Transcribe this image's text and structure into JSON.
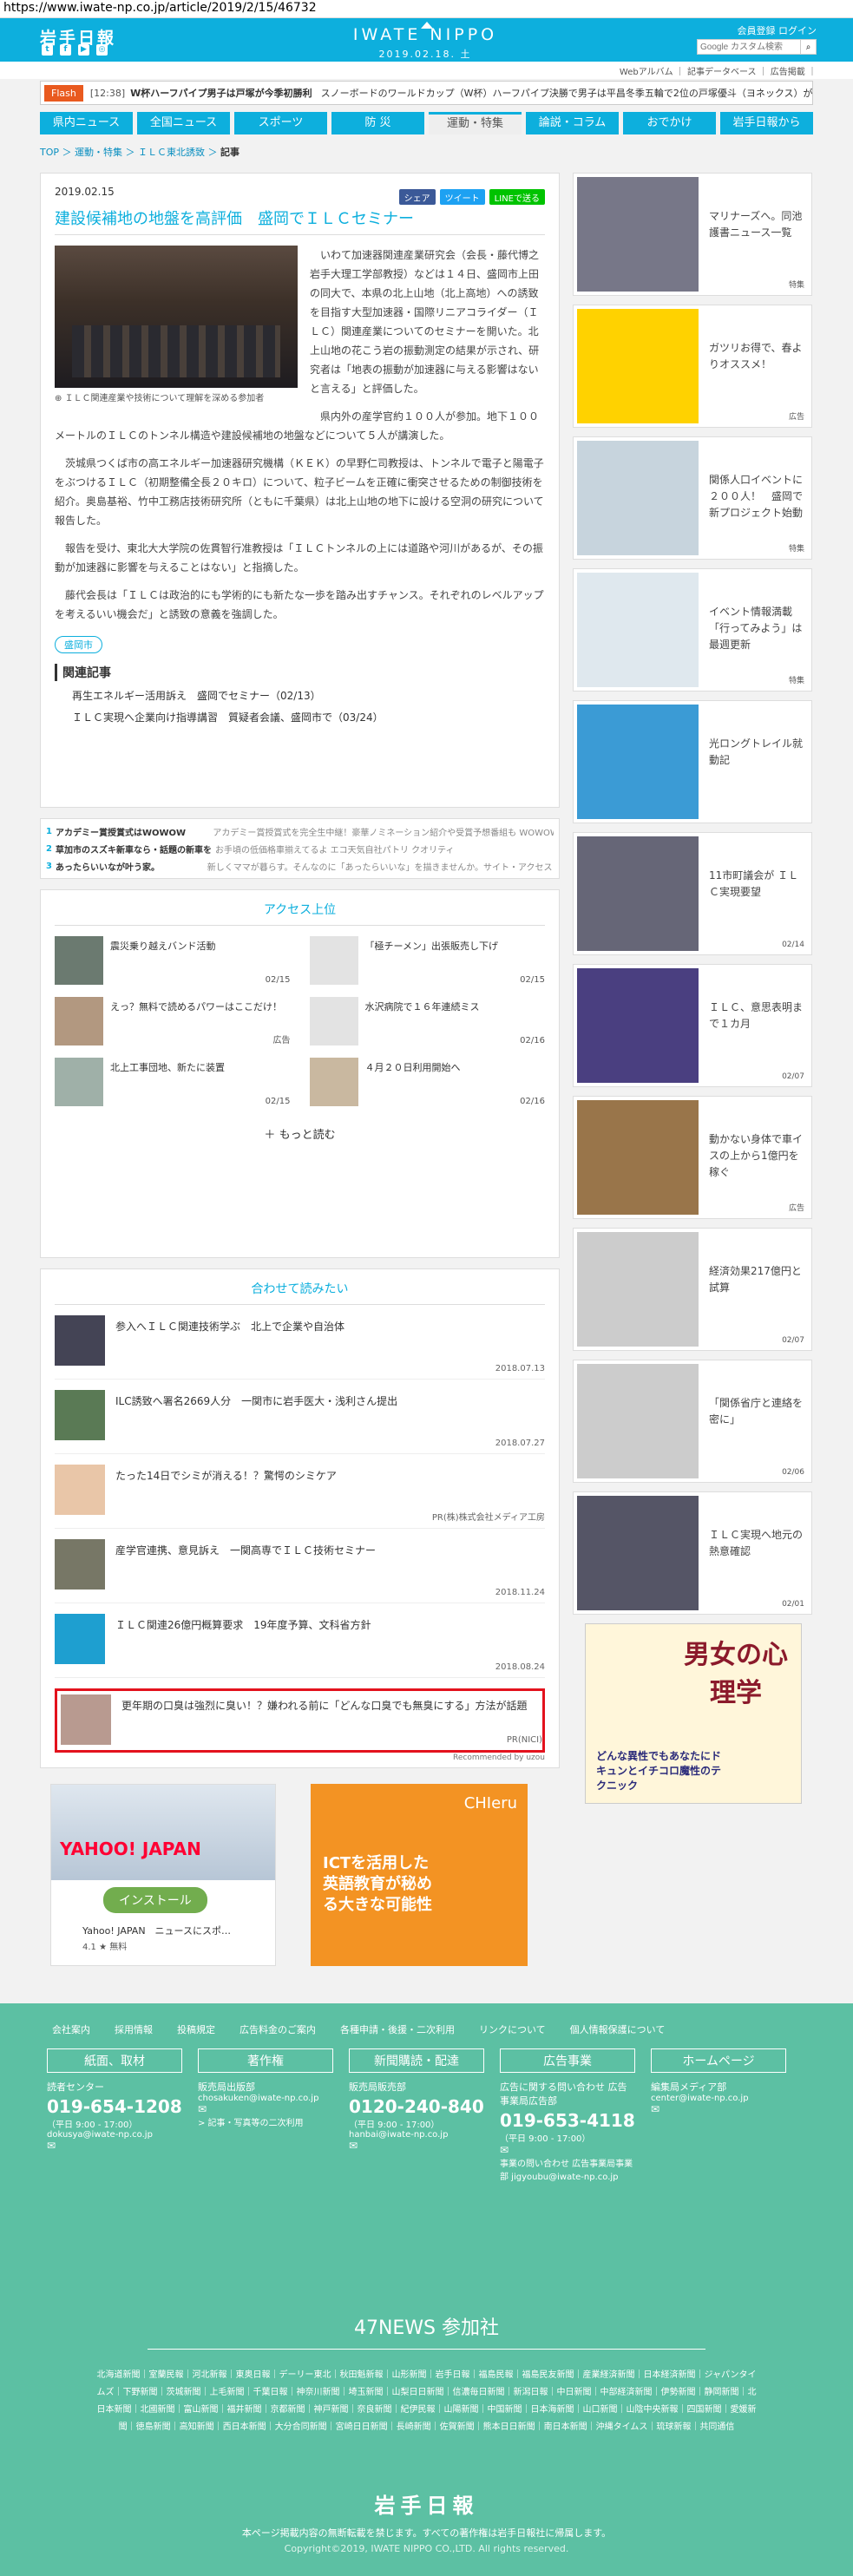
{
  "url": "https://www.iwate-np.co.jp/article/2019/2/15/46732",
  "site": {
    "logo": "岩手日報",
    "brand": "IWATE NIPPO",
    "date": "2019.02.18. 土",
    "auth": "会員登録 ログイン",
    "search_placeholder": "Google カスタム検索",
    "sublinks": "Webアルバム ｜ 記事データベース ｜ 広告掲載 ｜"
  },
  "flash": {
    "tag": "Flash",
    "time": "[12:38]",
    "head": "W杯ハーフパイプ男子は戸塚が今季初勝利",
    "text": "スノーボードのワールドカップ（W杯）ハーフパイプ決勝で男子は平昌冬季五輪で2位の戸塚優斗（ヨネックス）が今…"
  },
  "nav": [
    "県内ニュース",
    "全国ニュース",
    "スポーツ",
    "防 災",
    "運動・特集",
    "論説・コラム",
    "おでかけ",
    "岩手日報から"
  ],
  "crumb": {
    "top": "TOP",
    "a": "運動・特集",
    "b": "ＩＬＣ東北誘致",
    "c": "記事"
  },
  "article": {
    "date": "2019.02.15",
    "share": "シェア",
    "tweet": "ツイート",
    "line": "LINEで送る",
    "title": "建設候補地の地盤を高評価　盛岡でＩＬＣセミナー",
    "caption": "ＩＬＣ関連産業や技術について理解を深める参加者",
    "p1": "いわて加速器関連産業研究会（会長・藤代博之岩手大理工学部教授）などは１４日、盛岡市上田の同大で、本県の北上山地（北上高地）への誘致を目指す大型加速器・国際リニアコライダー（ＩＬＣ）関連産業についてのセミナーを開いた。北上山地の花こう岩の振動測定の結果が示され、研究者は「地表の振動が加速器に与える影響はないと言える」と評価した。",
    "p2": "県内外の産学官約１００人が参加。地下１００メートルのＩＬＣのトンネル構造や建設候補地の地盤などについて５人が講演した。",
    "p3": "茨城県つくば市の高エネルギー加速器研究機構（ＫＥＫ）の早野仁司教授は、トンネルで電子と陽電子をぶつけるＩＬＣ（初期整備全長２０キロ）について、粒子ビームを正確に衝突させるための制御技術を紹介。奥島基裕、竹中工務店技術研究所（ともに千葉県）は北上山地の地下に設ける空洞の研究について報告した。",
    "p4": "報告を受け、東北大大学院の佐貫智行准教授は「ＩＬＣトンネルの上には道路や河川があるが、その振動が加速器に影響を与えることはない」と指摘した。",
    "p5": "藤代会長は「ＩＬＣは政治的にも学術的にも新たな一歩を踏み出すチャンス。それぞれのレベルアップを考えるいい機会だ」と誘致の意義を強調した。",
    "tag": "盛岡市",
    "related_h": "関連記事",
    "related": [
      "再生エネルギー活用訴え　盛岡でセミナー（02/13）",
      "ＩＬＣ実現へ企業向け指導講習　質疑者会議、盛岡市で（03/24）"
    ]
  },
  "adlines": [
    {
      "n": "1",
      "a": "アカデミー賞授賞式はWOWOW",
      "b": "アカデミー賞授賞式を完全生中継！豪華ノミネーション紹介や受賞予想番組も WOWOW"
    },
    {
      "n": "2",
      "a": "草加市のスズキ新車なら・話題の新車を展示",
      "b": "お手頃の低価格車揃えてるよ エコ天気自社パトリ クオリティ"
    },
    {
      "n": "3",
      "a": "あったらいいなが叶う家。",
      "b": "新しくママが暮らす。そんなのに「あったらいいな」を描きませんか。サイト・アクセス 新築"
    }
  ],
  "access": {
    "title": "アクセス上位",
    "items": [
      {
        "t": "震災乗り越えバンド活動",
        "d": "02/15"
      },
      {
        "t": "「極チーメン」出張販売し下げ",
        "d": "02/15"
      },
      {
        "t": "えっ？無料で読めるパワーはここだけ！",
        "d": "広告"
      },
      {
        "t": "水沢病院で１６年連続ミス",
        "d": "02/16"
      },
      {
        "t": "北上工事団地、新たに装置",
        "d": "02/15"
      },
      {
        "t": "４月２０日利用開始へ",
        "d": "02/16"
      }
    ],
    "more": "もっと読む"
  },
  "together": {
    "title": "合わせて読みたい",
    "items": [
      {
        "t": "参入へＩＬＣ関連技術学ぶ　北上で企業や自治体",
        "d": "2018.07.13"
      },
      {
        "t": "ILC誘致へ署名2669人分　一関市に岩手医大・浅利さん提出",
        "d": "2018.07.27"
      },
      {
        "t": "たった14日でシミが消える！？驚愕のシミケア",
        "d": "PR(株)株式会社メディア工房"
      },
      {
        "t": "産学官連携、意見訴え　一関高専でＩＬＣ技術セミナー",
        "d": "2018.11.24"
      },
      {
        "t": "ＩＬＣ関連26億円概算要求　19年度予算、文科省方針",
        "d": "2018.08.24"
      },
      {
        "t": "更年期の口臭は強烈に臭い！？嫌われる前に「どんな口臭でも無臭にする」方法が話題",
        "d": "PR(NICI)"
      }
    ],
    "rec": "Recommended by uzou"
  },
  "bottom_ads": {
    "yahoo": "YAHOO! JAPAN",
    "install": "インストール",
    "app": "Yahoo! JAPAN　ニュースにスポ…",
    "rating": "4.1 ★ 無料",
    "chieru_title": "ICTを活用した英語教育が秘める大きな可能性",
    "chieru_brand": "CHIeru"
  },
  "side": [
    {
      "t": "マリナーズへ。同池護書ニュース一覧",
      "d": "特集",
      "c": "#778"
    },
    {
      "t": "ガツリお得で、春よりオススメ！",
      "d": "広告",
      "c": "#ffd200"
    },
    {
      "t": "関係人口イベントに２００人！　盛岡で新プロジェクト始動",
      "d": "特集",
      "c": "#c7d4dd"
    },
    {
      "t": "イベント情報満載「行ってみよう」は最週更新",
      "d": "特集",
      "c": "#dfe8ee"
    },
    {
      "t": "光ロングトレイル就動記",
      "d": "",
      "c": "#3b9bd5"
    },
    {
      "t": "11市町議会が ＩＬＣ実現要望",
      "d": "02/14",
      "c": "#667"
    },
    {
      "t": "ＩＬＣ、意思表明まで１カ月",
      "d": "02/07",
      "c": "#4a3f80"
    },
    {
      "t": "動かない身体で車イスの上から1億円を稼ぐ",
      "d": "広告",
      "c": "#99754a"
    },
    {
      "t": "経済効果217億円と試算",
      "d": "02/07",
      "c": "#c8c8c8"
    },
    {
      "t": "「関係省庁と連絡を密に」",
      "d": "02/06",
      "c": "#c8c8c8"
    },
    {
      "t": "ＩＬＣ実現へ地元の熱意確認",
      "d": "02/01",
      "c": "#556"
    }
  ],
  "side_ad": {
    "title": "男女の心理学",
    "sub": "どんな異性でもあなたにドキュンとイチコロ魔性のテクニック"
  },
  "footer": {
    "links": [
      "会社案内",
      "採用情報",
      "投稿規定",
      "広告料金のご案内",
      "各種申請・後援・二次利用",
      "リンクについて",
      "個人情報保護について"
    ],
    "cols": [
      {
        "h": "紙面、取材",
        "s": "読者センター",
        "tel": "019-654-1208",
        "hours": "（平日 9:00 - 17:00）",
        "mail": "dokusya@iwate-np.co.jp"
      },
      {
        "h": "著作権",
        "s": "販売局出版部",
        "tel": "",
        "hours": "",
        "mail": "chosakuken@iwate-np.co.jp",
        "extra": "> 記事・写真等の二次利用"
      },
      {
        "h": "新聞購読・配達",
        "s": "販売局販売部",
        "tel": "0120-240-840",
        "hours": "（平日 9:00 - 17:00）",
        "mail": "hanbai@iwate-np.co.jp"
      },
      {
        "h": "広告事業",
        "s": "広告に関する問い合わせ 広告事業局広告部",
        "tel": "019-653-4118",
        "hours": "（平日 9:00 - 17:00）",
        "mail": "",
        "extra": "事業の問い合わせ 広告事業局事業部 jigyoubu@iwate-np.co.jp"
      },
      {
        "h": "ホームページ",
        "s": "編集局メディア部",
        "tel": "",
        "hours": "",
        "mail": "center@iwate-np.co.jp"
      }
    ],
    "n47": "47NEWS 参加社",
    "papers": "北海道新聞｜室蘭民報｜河北新報｜東奥日報｜デーリー東北｜秋田魁新報｜山形新聞｜岩手日報｜福島民報｜福島民友新聞｜産業経済新聞｜日本経済新聞｜ジャパンタイムズ｜下野新聞｜茨城新聞｜上毛新聞｜千葉日報｜神奈川新聞｜埼玉新聞｜山梨日日新聞｜信濃毎日新聞｜新潟日報｜中日新聞｜中部経済新聞｜伊勢新聞｜静岡新聞｜北日本新聞｜北國新聞｜富山新聞｜福井新聞｜京都新聞｜神戸新聞｜奈良新聞｜紀伊民報｜山陽新聞｜中国新聞｜日本海新聞｜山口新聞｜山陰中央新報｜四国新聞｜愛媛新聞｜徳島新聞｜高知新聞｜西日本新聞｜大分合同新聞｜宮崎日日新聞｜長崎新聞｜佐賀新聞｜熊本日日新聞｜南日本新聞｜沖縄タイムス｜琉球新報｜共同通信",
    "logo": "岩手日報",
    "note": "本ページ掲載内容の無断転載を禁じます。すべての著作権は岩手日報社に帰属します。",
    "copy": "Copyright©2019, IWATE NIPPO CO.,LTD. All rights reserved."
  }
}
